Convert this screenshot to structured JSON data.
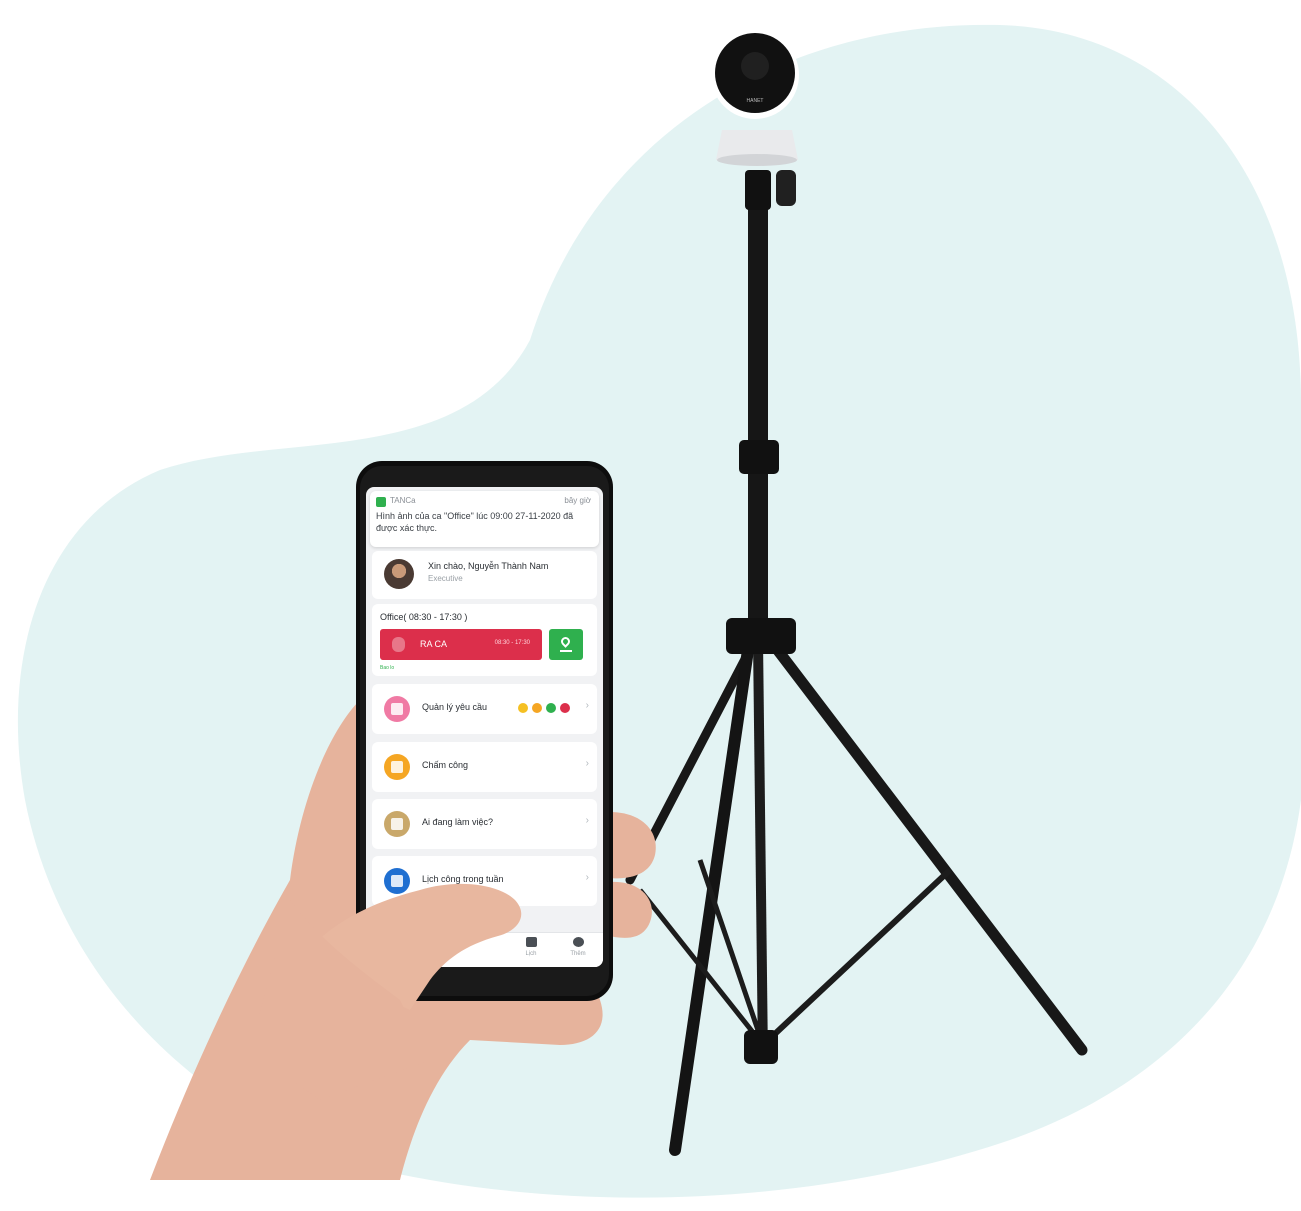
{
  "notification": {
    "app_name": "TANCa",
    "time": "bây giờ",
    "message": "Hình ảnh của ca \"Office\" lúc 09:00 27-11-2020 đã được xác thực."
  },
  "user": {
    "greeting": "Xin chào, Nguyễn Thành Nam",
    "role": "Executive"
  },
  "shift": {
    "title": "Office( 08:30 - 17:30 )",
    "checkout_label": "RA CA",
    "checkout_hours": "08:30 - 17:30",
    "small_text": "Bao lo"
  },
  "menu": {
    "requests": "Quản lý yêu cầu",
    "attendance": "Chấm công",
    "who_working": "Ai đang làm việc?",
    "weekly_schedule": "Lịch công trong tuần"
  },
  "tabs": [
    "Lịch",
    "Thêm"
  ],
  "camera_brand": "HANET",
  "colors": {
    "blob": "#e3f3f3",
    "red": "#dc2f4b",
    "green": "#2fb04e",
    "requests_icon": "#f07aa4",
    "attendance_icon": "#f5a623",
    "who_working_icon": "#c9a86a",
    "weekly_icon": "#1f6fd1"
  }
}
